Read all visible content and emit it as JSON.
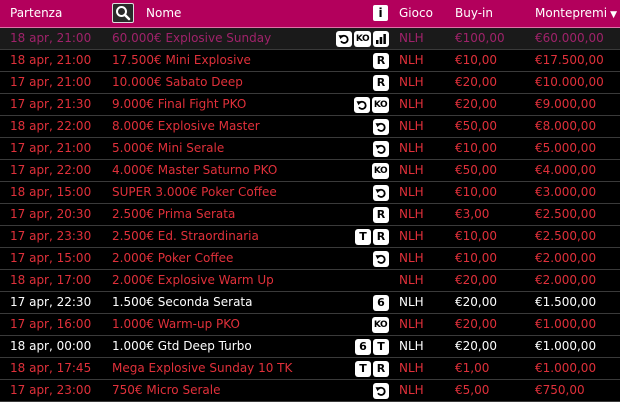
{
  "header": {
    "start_label": "Partenza",
    "name_label": "Nome",
    "info_label": "i",
    "game_label": "Gioco",
    "buyin_label": "Buy-in",
    "prize_label": "Montepremi",
    "sort_icon": "caret-down-icon",
    "search_icon": "search-icon"
  },
  "colors": {
    "header_bg": "#b3005c",
    "row_red": "#e0303a",
    "row_white": "#ffffff",
    "row_highlight": "#a0226a",
    "background": "#000000"
  },
  "rows": [
    {
      "date": "18 apr, 21:00",
      "name": "60.000€ Explosive Sunday",
      "icons": [
        "rebuy",
        "ko",
        "chart"
      ],
      "game": "NLH",
      "buyin": "€100,00",
      "prize": "€60.000,00",
      "style": "highlight"
    },
    {
      "date": "18 apr, 21:00",
      "name": "17.500€ Mini Explosive",
      "icons": [
        "R"
      ],
      "game": "NLH",
      "buyin": "€10,00",
      "prize": "€17.500,00",
      "style": "red"
    },
    {
      "date": "17 apr, 21:00",
      "name": "10.000€ Sabato Deep",
      "icons": [
        "R"
      ],
      "game": "NLH",
      "buyin": "€20,00",
      "prize": "€10.000,00",
      "style": "red"
    },
    {
      "date": "17 apr, 21:30",
      "name": "9.000€ Final Fight PKO",
      "icons": [
        "rebuy",
        "ko"
      ],
      "game": "NLH",
      "buyin": "€20,00",
      "prize": "€9.000,00",
      "style": "red"
    },
    {
      "date": "18 apr, 22:00",
      "name": "8.000€ Explosive Master",
      "icons": [
        "rebuy"
      ],
      "game": "NLH",
      "buyin": "€50,00",
      "prize": "€8.000,00",
      "style": "red"
    },
    {
      "date": "17 apr, 21:00",
      "name": "5.000€ Mini Serale",
      "icons": [
        "rebuy"
      ],
      "game": "NLH",
      "buyin": "€10,00",
      "prize": "€5.000,00",
      "style": "red"
    },
    {
      "date": "17 apr, 22:00",
      "name": "4.000€ Master Saturno PKO",
      "icons": [
        "ko"
      ],
      "game": "NLH",
      "buyin": "€50,00",
      "prize": "€4.000,00",
      "style": "red"
    },
    {
      "date": "18 apr, 15:00",
      "name": "SUPER 3.000€ Poker Coffee",
      "icons": [
        "rebuy"
      ],
      "game": "NLH",
      "buyin": "€10,00",
      "prize": "€3.000,00",
      "style": "red"
    },
    {
      "date": "17 apr, 20:30",
      "name": "2.500€ Prima Serata",
      "icons": [
        "R"
      ],
      "game": "NLH",
      "buyin": "€3,00",
      "prize": "€2.500,00",
      "style": "red"
    },
    {
      "date": "17 apr, 23:30",
      "name": "2.500€ Ed. Straordinaria",
      "icons": [
        "T",
        "R"
      ],
      "game": "NLH",
      "buyin": "€10,00",
      "prize": "€2.500,00",
      "style": "red"
    },
    {
      "date": "17 apr, 15:00",
      "name": "2.000€ Poker Coffee",
      "icons": [
        "rebuy"
      ],
      "game": "NLH",
      "buyin": "€10,00",
      "prize": "€2.000,00",
      "style": "red"
    },
    {
      "date": "18 apr, 17:00",
      "name": "2.000€ Explosive Warm Up",
      "icons": [],
      "game": "NLH",
      "buyin": "€20,00",
      "prize": "€2.000,00",
      "style": "red"
    },
    {
      "date": "17 apr, 22:30",
      "name": "1.500€ Seconda Serata",
      "icons": [
        "6"
      ],
      "game": "NLH",
      "buyin": "€20,00",
      "prize": "€1.500,00",
      "style": "white"
    },
    {
      "date": "17 apr, 16:00",
      "name": "1.000€ Warm-up PKO",
      "icons": [
        "ko"
      ],
      "game": "NLH",
      "buyin": "€20,00",
      "prize": "€1.000,00",
      "style": "red"
    },
    {
      "date": "18 apr, 00:00",
      "name": "1.000€ Gtd Deep Turbo",
      "icons": [
        "6",
        "T"
      ],
      "game": "NLH",
      "buyin": "€20,00",
      "prize": "€1.000,00",
      "style": "white"
    },
    {
      "date": "18 apr, 17:45",
      "name": "Mega Explosive Sunday 10 TK",
      "icons": [
        "T",
        "R"
      ],
      "game": "NLH",
      "buyin": "€1,00",
      "prize": "€1.000,00",
      "style": "red"
    },
    {
      "date": "17 apr, 23:00",
      "name": "750€ Micro Serale",
      "icons": [
        "rebuy"
      ],
      "game": "NLH",
      "buyin": "€5,00",
      "prize": "€750,00",
      "style": "red"
    }
  ]
}
